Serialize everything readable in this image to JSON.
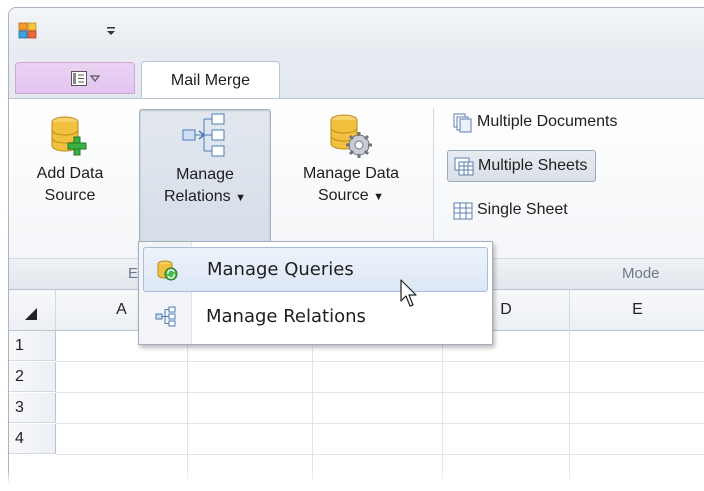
{
  "ribbon": {
    "tab_label": "Mail Merge",
    "buttons": {
      "add_data_source": [
        "Add Data",
        "Source"
      ],
      "manage_relations": [
        "Manage",
        "Relations"
      ],
      "manage_data_source": [
        "Manage Data",
        "Source"
      ]
    },
    "mode_options": {
      "multiple_documents": "Multiple Documents",
      "multiple_sheets": "Multiple Sheets",
      "single_sheet": "Single Sheet"
    },
    "selected_mode": "Multiple Sheets",
    "groups": {
      "external": "Ex",
      "mode": "Mode"
    }
  },
  "dropdown_menu": {
    "items": [
      "Manage Queries",
      "Manage Relations"
    ],
    "highlighted": "Manage Queries"
  },
  "grid": {
    "columns": [
      "A",
      "",
      "",
      "D",
      "E"
    ],
    "rows": [
      "1",
      "2",
      "3",
      "4"
    ]
  },
  "icons": {
    "app": "app-icon",
    "qat": "quick-access-dropdown-icon",
    "app_menu": "app-menu-icon",
    "add_data_source": "database-add-icon",
    "manage_relations": "relations-icon",
    "manage_data_source": "database-gear-icon",
    "multiple_documents": "multiple-documents-icon",
    "multiple_sheets": "multiple-sheets-icon",
    "single_sheet": "single-sheet-icon",
    "manage_queries": "manage-queries-icon",
    "pointer": "mouse-pointer-icon"
  },
  "colors": {
    "highlight": "#dce7f5",
    "app_menu": "#e2c4ef",
    "accent_green": "#2e9a2e"
  }
}
